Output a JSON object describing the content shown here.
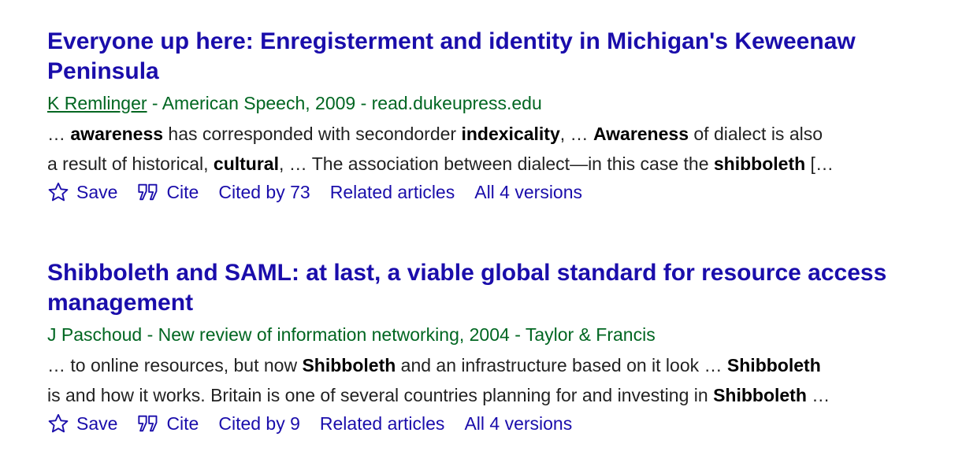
{
  "colors": {
    "title": "#1a0dab",
    "byline": "#006621",
    "snippet": "#222222",
    "action": "#1a0dab"
  },
  "results": [
    {
      "title_pre_bold": "",
      "title_bold": "",
      "title_rest": "Everyone up here: Enregisterment and identity in Michigan's Keweenaw Peninsula",
      "author": "K Remlinger",
      "byline_rest": " - American Speech, 2009 - read.dukeupress.edu",
      "snippet": [
        [
          {
            "t": "… ",
            "b": false
          },
          {
            "t": "awareness",
            "b": true
          },
          {
            "t": " has corresponded with secondorder ",
            "b": false
          },
          {
            "t": "indexicality",
            "b": true
          },
          {
            "t": ", … ",
            "b": false
          },
          {
            "t": "Awareness",
            "b": true
          },
          {
            "t": " of dialect is also",
            "b": false
          }
        ],
        [
          {
            "t": "a result of historical, ",
            "b": false
          },
          {
            "t": "cultural",
            "b": true
          },
          {
            "t": ", … The association between dialect—in this case the ",
            "b": false
          },
          {
            "t": "shibboleth",
            "b": true
          },
          {
            "t": " […",
            "b": false
          }
        ]
      ],
      "actions": {
        "save": "Save",
        "cite": "Cite",
        "cited_by": "Cited by 73",
        "related": "Related articles",
        "versions": "All 4 versions"
      }
    },
    {
      "title_pre_bold": "",
      "title_bold": "Shibboleth",
      "title_rest": " and SAML: at last, a viable global standard for resource access management",
      "author": "J Paschoud",
      "byline_rest": " - New review of information networking, 2004 - Taylor & Francis",
      "snippet": [
        [
          {
            "t": "… to online resources, but now ",
            "b": false
          },
          {
            "t": "Shibboleth",
            "b": true
          },
          {
            "t": " and an infrastructure based on it look … ",
            "b": false
          },
          {
            "t": "Shibboleth",
            "b": true
          }
        ],
        [
          {
            "t": "is and how it works. Britain is one of several countries planning for and investing in ",
            "b": false
          },
          {
            "t": "Shibboleth",
            "b": true
          },
          {
            "t": " …",
            "b": false
          }
        ]
      ],
      "actions": {
        "save": "Save",
        "cite": "Cite",
        "cited_by": "Cited by 9",
        "related": "Related articles",
        "versions": "All 4 versions"
      }
    }
  ]
}
